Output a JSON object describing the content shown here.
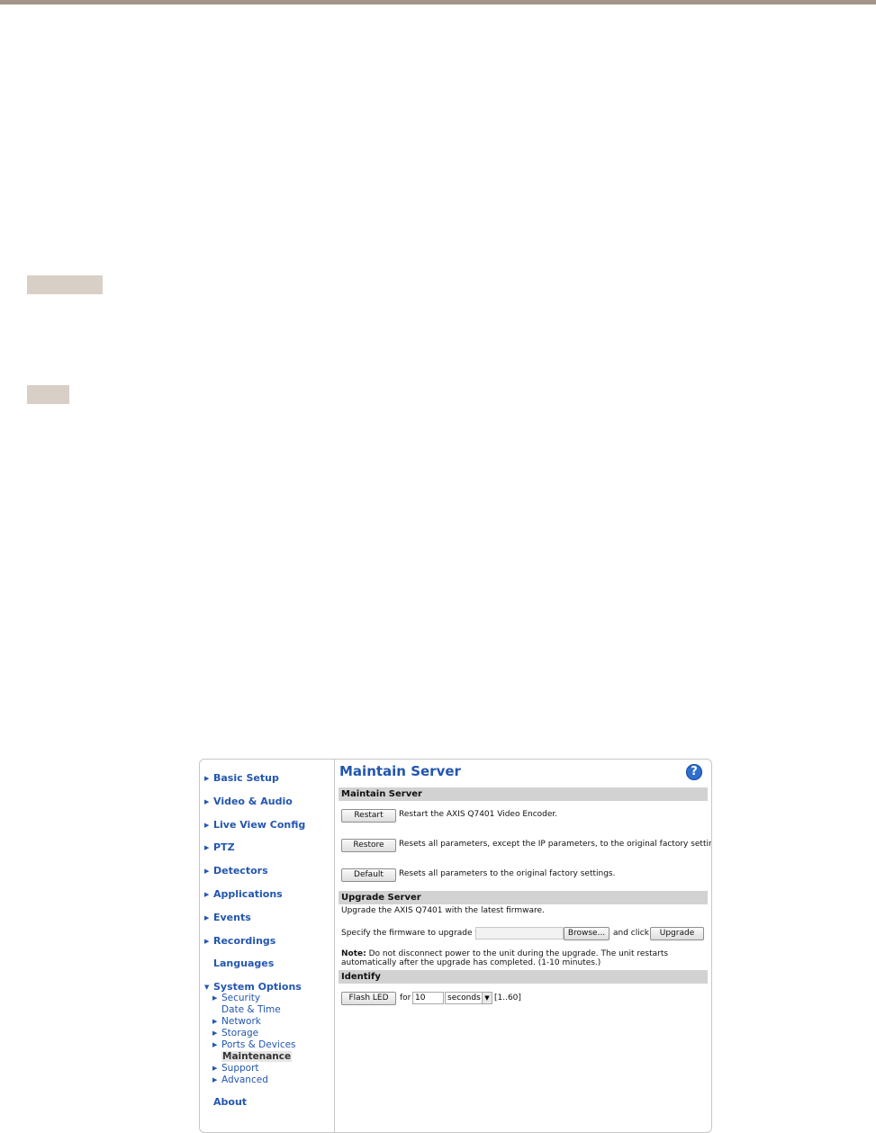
{
  "colors": {
    "top_bar": "#a39689",
    "tag": "#d8d0c7",
    "link": "#2356b0",
    "section_header": "#d2d2d2"
  },
  "sidebar": {
    "items": [
      {
        "label": "Basic Setup",
        "arrow": "right"
      },
      {
        "label": "Video & Audio",
        "arrow": "right"
      },
      {
        "label": "Live View Config",
        "arrow": "right"
      },
      {
        "label": "PTZ",
        "arrow": "right"
      },
      {
        "label": "Detectors",
        "arrow": "right"
      },
      {
        "label": "Applications",
        "arrow": "right"
      },
      {
        "label": "Events",
        "arrow": "right"
      },
      {
        "label": "Recordings",
        "arrow": "right"
      },
      {
        "label": "Languages",
        "arrow": "none"
      },
      {
        "label": "System Options",
        "arrow": "down"
      },
      {
        "label": "About",
        "arrow": "none"
      }
    ],
    "sub_items": [
      {
        "label": "Security",
        "arrow": "right"
      },
      {
        "label": "Date & Time",
        "arrow": "none"
      },
      {
        "label": "Network",
        "arrow": "right"
      },
      {
        "label": "Storage",
        "arrow": "right"
      },
      {
        "label": "Ports & Devices",
        "arrow": "right"
      },
      {
        "label": "Maintenance",
        "arrow": "none",
        "active": true
      },
      {
        "label": "Support",
        "arrow": "right"
      },
      {
        "label": "Advanced",
        "arrow": "right"
      }
    ]
  },
  "main": {
    "title": "Maintain Server",
    "help_icon": "?",
    "maintain": {
      "header": "Maintain Server",
      "restart_label": "Restart",
      "restart_desc": "Restart the AXIS Q7401 Video Encoder.",
      "restore_label": "Restore",
      "restore_desc": "Resets all parameters, except the IP parameters, to the original factory settings.",
      "default_label": "Default",
      "default_desc": "Resets all parameters to the original factory settings."
    },
    "upgrade": {
      "header": "Upgrade Server",
      "intro": "Upgrade the AXIS Q7401 with the latest firmware.",
      "specify": "Specify the firmware to upgrade to:",
      "file_value": "",
      "browse_label": "Browse...",
      "and_click": "and click",
      "upgrade_label": "Upgrade",
      "note_bold": "Note:",
      "note_text": "Do not disconnect power to the unit during the upgrade. The unit restarts automatically after the upgrade has completed. (1-10 minutes.)"
    },
    "identify": {
      "header": "Identify",
      "flash_label": "Flash LED",
      "for_text": "for",
      "duration_value": "10",
      "unit_selected": "seconds",
      "range_text": "[1..60]"
    }
  }
}
